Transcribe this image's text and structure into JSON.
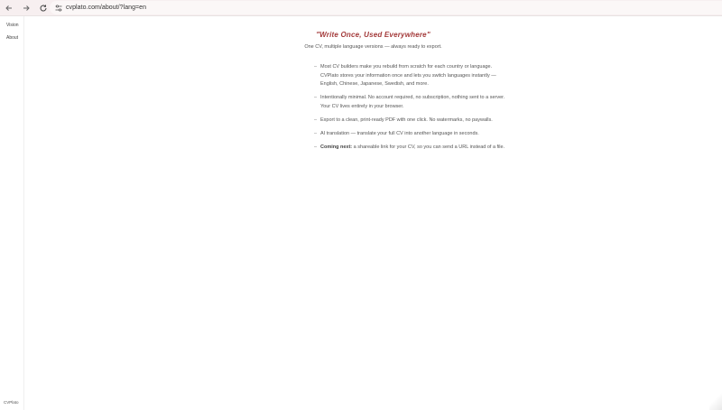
{
  "browser": {
    "url": "cvplato.com/about/?lang=en",
    "icons": {
      "back": "arrow-left-icon",
      "forward": "arrow-right-icon",
      "reload": "reload-icon",
      "site": "site-settings-icon"
    }
  },
  "sidebar": {
    "items": [
      {
        "label": "Vision"
      },
      {
        "label": "About"
      }
    ],
    "brand": "CVPlato"
  },
  "main": {
    "headline": "\"Write Once, Used Everywhere\"",
    "subhead": "One CV, multiple language versions — always ready to export.",
    "points": [
      {
        "dash": "–",
        "strong": "",
        "text": "Most CV builders make you rebuild from scratch for each country or language. CVPlato stores your information once and lets you switch languages instantly — English, Chinese, Japanese, Swedish, and more."
      },
      {
        "dash": "–",
        "strong": "",
        "text": "Intentionally minimal. No account required, no subscription, nothing sent to a server. Your CV lives entirely in your browser."
      },
      {
        "dash": "–",
        "strong": "",
        "text": "Export to a clean, print-ready PDF with one click. No watermarks, no paywalls."
      },
      {
        "dash": "–",
        "strong": "",
        "text": "AI translation — translate your full CV into another language in seconds."
      },
      {
        "dash": "–",
        "strong": "Coming next:",
        "text": " a shareable link for your CV, so you can send a URL instead of a file."
      }
    ]
  },
  "colors": {
    "accent": "#a33a3a",
    "toolbar_bg": "#f7eff0",
    "text": "#555555"
  }
}
